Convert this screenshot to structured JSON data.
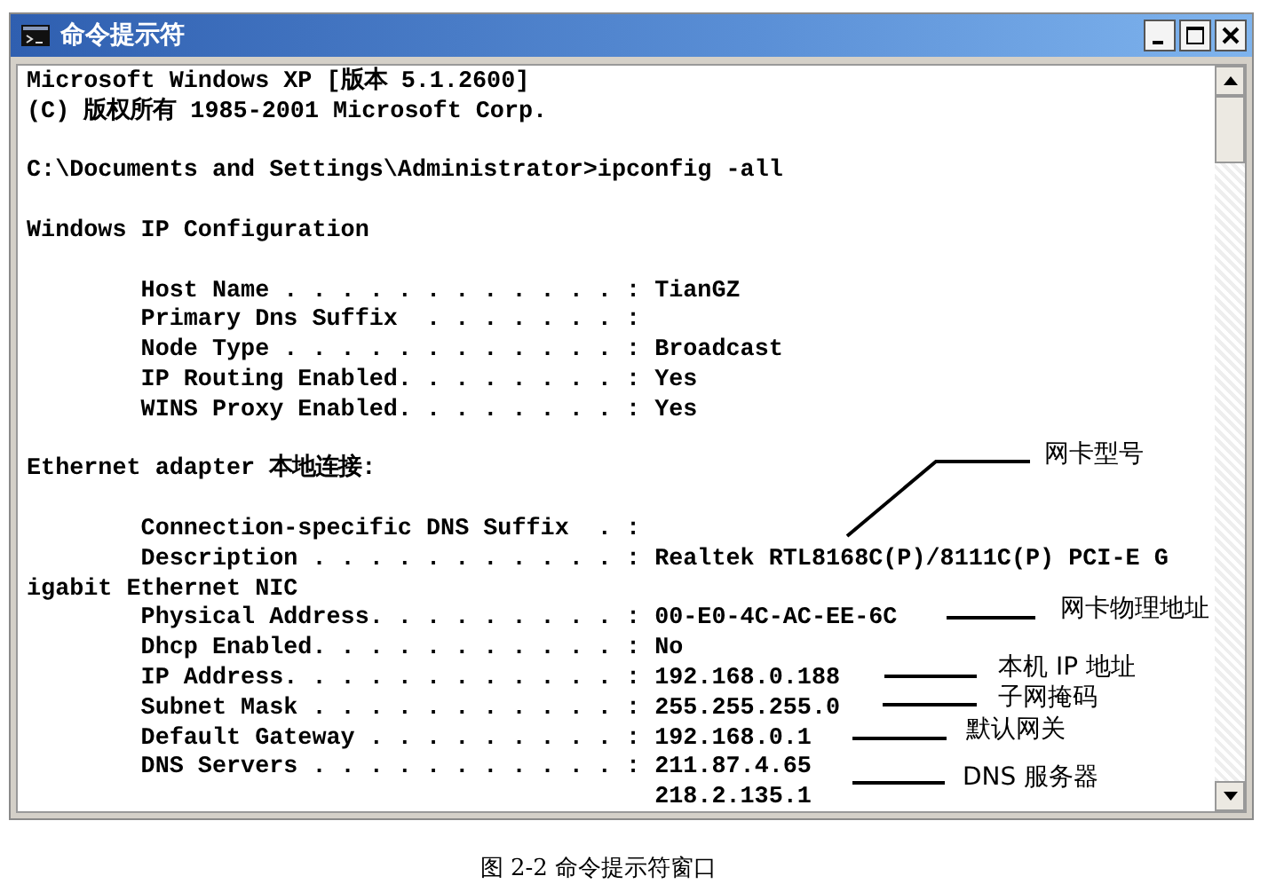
{
  "window": {
    "title": "命令提示符"
  },
  "console": {
    "blocks": [
      [
        {
          "kind": "plain",
          "text": "Microsoft Windows XP [版本 5.1.2600]"
        },
        {
          "kind": "plain",
          "text": "(C) 版权所有 1985-2001 Microsoft Corp."
        }
      ],
      [
        {
          "kind": "plain",
          "text": "C:\\Documents and Settings\\Administrator>ipconfig -all"
        }
      ],
      [
        {
          "kind": "plain",
          "text": "Windows IP Configuration"
        }
      ],
      [
        {
          "kind": "field",
          "text": "Host Name . . . . . . . . . . . . : TianGZ"
        },
        {
          "kind": "field",
          "text": "Primary Dns Suffix  . . . . . . . :"
        },
        {
          "kind": "field",
          "text": "Node Type . . . . . . . . . . . . : Broadcast"
        },
        {
          "kind": "field",
          "text": "IP Routing Enabled. . . . . . . . : Yes"
        },
        {
          "kind": "field",
          "text": "WINS Proxy Enabled. . . . . . . . : Yes"
        }
      ],
      [
        {
          "kind": "plain",
          "text": "Ethernet adapter 本地连接:"
        }
      ],
      [
        {
          "kind": "field",
          "text": "Connection-specific DNS Suffix  . :"
        },
        {
          "kind": "field",
          "text": "Description . . . . . . . . . . . : Realtek RTL8168C(P)/8111C(P) PCI-E G"
        },
        {
          "kind": "plain",
          "text": "igabit Ethernet NIC"
        },
        {
          "kind": "field",
          "text": "Physical Address. . . . . . . . . : 00-E0-4C-AC-EE-6C"
        },
        {
          "kind": "field",
          "text": "Dhcp Enabled. . . . . . . . . . . : No"
        },
        {
          "kind": "field",
          "text": "IP Address. . . . . . . . . . . . : 192.168.0.188"
        },
        {
          "kind": "field",
          "text": "Subnet Mask . . . . . . . . . . . : 255.255.255.0"
        },
        {
          "kind": "field",
          "text": "Default Gateway . . . . . . . . . : 192.168.0.1"
        },
        {
          "kind": "field",
          "text": "DNS Servers . . . . . . . . . . . : 211.87.4.65"
        },
        {
          "kind": "continuation",
          "text": "218.2.135.1"
        }
      ]
    ]
  },
  "annotations": [
    {
      "text": "网卡型号"
    },
    {
      "text": "网卡物理地址"
    },
    {
      "text": "本机 IP 地址"
    },
    {
      "text": "子网掩码"
    },
    {
      "text": "默认网关"
    },
    {
      "text": "DNS 服务器"
    }
  ],
  "caption": "图 2-2  命令提示符窗口"
}
